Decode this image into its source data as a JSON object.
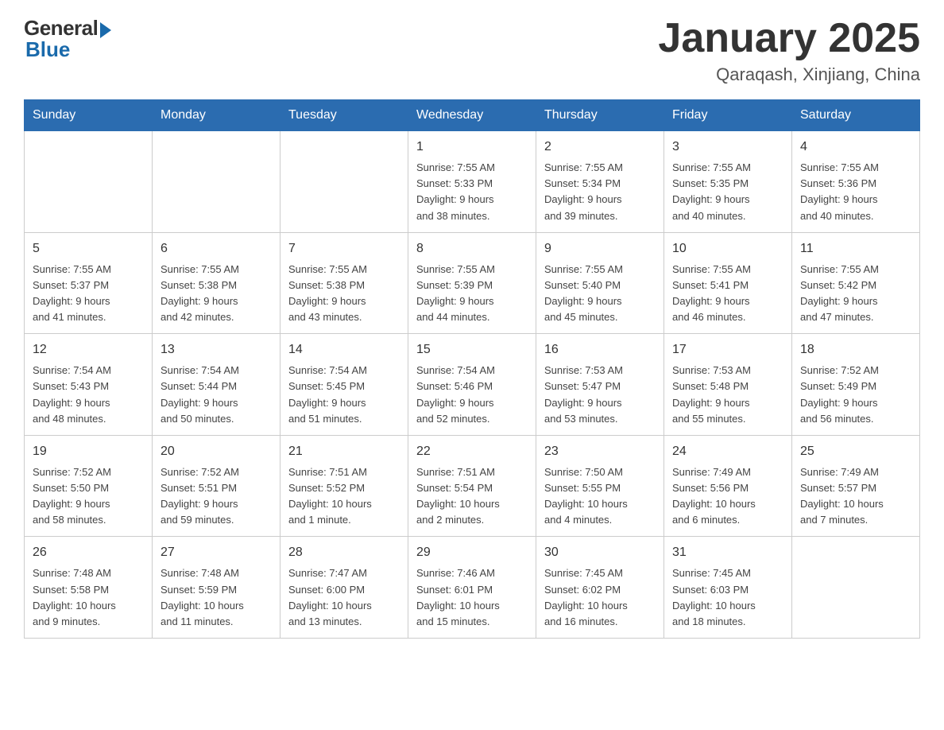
{
  "header": {
    "logo_general": "General",
    "logo_blue": "Blue",
    "title": "January 2025",
    "location": "Qaraqash, Xinjiang, China"
  },
  "weekdays": [
    "Sunday",
    "Monday",
    "Tuesday",
    "Wednesday",
    "Thursday",
    "Friday",
    "Saturday"
  ],
  "weeks": [
    [
      {
        "day": "",
        "info": ""
      },
      {
        "day": "",
        "info": ""
      },
      {
        "day": "",
        "info": ""
      },
      {
        "day": "1",
        "info": "Sunrise: 7:55 AM\nSunset: 5:33 PM\nDaylight: 9 hours\nand 38 minutes."
      },
      {
        "day": "2",
        "info": "Sunrise: 7:55 AM\nSunset: 5:34 PM\nDaylight: 9 hours\nand 39 minutes."
      },
      {
        "day": "3",
        "info": "Sunrise: 7:55 AM\nSunset: 5:35 PM\nDaylight: 9 hours\nand 40 minutes."
      },
      {
        "day": "4",
        "info": "Sunrise: 7:55 AM\nSunset: 5:36 PM\nDaylight: 9 hours\nand 40 minutes."
      }
    ],
    [
      {
        "day": "5",
        "info": "Sunrise: 7:55 AM\nSunset: 5:37 PM\nDaylight: 9 hours\nand 41 minutes."
      },
      {
        "day": "6",
        "info": "Sunrise: 7:55 AM\nSunset: 5:38 PM\nDaylight: 9 hours\nand 42 minutes."
      },
      {
        "day": "7",
        "info": "Sunrise: 7:55 AM\nSunset: 5:38 PM\nDaylight: 9 hours\nand 43 minutes."
      },
      {
        "day": "8",
        "info": "Sunrise: 7:55 AM\nSunset: 5:39 PM\nDaylight: 9 hours\nand 44 minutes."
      },
      {
        "day": "9",
        "info": "Sunrise: 7:55 AM\nSunset: 5:40 PM\nDaylight: 9 hours\nand 45 minutes."
      },
      {
        "day": "10",
        "info": "Sunrise: 7:55 AM\nSunset: 5:41 PM\nDaylight: 9 hours\nand 46 minutes."
      },
      {
        "day": "11",
        "info": "Sunrise: 7:55 AM\nSunset: 5:42 PM\nDaylight: 9 hours\nand 47 minutes."
      }
    ],
    [
      {
        "day": "12",
        "info": "Sunrise: 7:54 AM\nSunset: 5:43 PM\nDaylight: 9 hours\nand 48 minutes."
      },
      {
        "day": "13",
        "info": "Sunrise: 7:54 AM\nSunset: 5:44 PM\nDaylight: 9 hours\nand 50 minutes."
      },
      {
        "day": "14",
        "info": "Sunrise: 7:54 AM\nSunset: 5:45 PM\nDaylight: 9 hours\nand 51 minutes."
      },
      {
        "day": "15",
        "info": "Sunrise: 7:54 AM\nSunset: 5:46 PM\nDaylight: 9 hours\nand 52 minutes."
      },
      {
        "day": "16",
        "info": "Sunrise: 7:53 AM\nSunset: 5:47 PM\nDaylight: 9 hours\nand 53 minutes."
      },
      {
        "day": "17",
        "info": "Sunrise: 7:53 AM\nSunset: 5:48 PM\nDaylight: 9 hours\nand 55 minutes."
      },
      {
        "day": "18",
        "info": "Sunrise: 7:52 AM\nSunset: 5:49 PM\nDaylight: 9 hours\nand 56 minutes."
      }
    ],
    [
      {
        "day": "19",
        "info": "Sunrise: 7:52 AM\nSunset: 5:50 PM\nDaylight: 9 hours\nand 58 minutes."
      },
      {
        "day": "20",
        "info": "Sunrise: 7:52 AM\nSunset: 5:51 PM\nDaylight: 9 hours\nand 59 minutes."
      },
      {
        "day": "21",
        "info": "Sunrise: 7:51 AM\nSunset: 5:52 PM\nDaylight: 10 hours\nand 1 minute."
      },
      {
        "day": "22",
        "info": "Sunrise: 7:51 AM\nSunset: 5:54 PM\nDaylight: 10 hours\nand 2 minutes."
      },
      {
        "day": "23",
        "info": "Sunrise: 7:50 AM\nSunset: 5:55 PM\nDaylight: 10 hours\nand 4 minutes."
      },
      {
        "day": "24",
        "info": "Sunrise: 7:49 AM\nSunset: 5:56 PM\nDaylight: 10 hours\nand 6 minutes."
      },
      {
        "day": "25",
        "info": "Sunrise: 7:49 AM\nSunset: 5:57 PM\nDaylight: 10 hours\nand 7 minutes."
      }
    ],
    [
      {
        "day": "26",
        "info": "Sunrise: 7:48 AM\nSunset: 5:58 PM\nDaylight: 10 hours\nand 9 minutes."
      },
      {
        "day": "27",
        "info": "Sunrise: 7:48 AM\nSunset: 5:59 PM\nDaylight: 10 hours\nand 11 minutes."
      },
      {
        "day": "28",
        "info": "Sunrise: 7:47 AM\nSunset: 6:00 PM\nDaylight: 10 hours\nand 13 minutes."
      },
      {
        "day": "29",
        "info": "Sunrise: 7:46 AM\nSunset: 6:01 PM\nDaylight: 10 hours\nand 15 minutes."
      },
      {
        "day": "30",
        "info": "Sunrise: 7:45 AM\nSunset: 6:02 PM\nDaylight: 10 hours\nand 16 minutes."
      },
      {
        "day": "31",
        "info": "Sunrise: 7:45 AM\nSunset: 6:03 PM\nDaylight: 10 hours\nand 18 minutes."
      },
      {
        "day": "",
        "info": ""
      }
    ]
  ]
}
